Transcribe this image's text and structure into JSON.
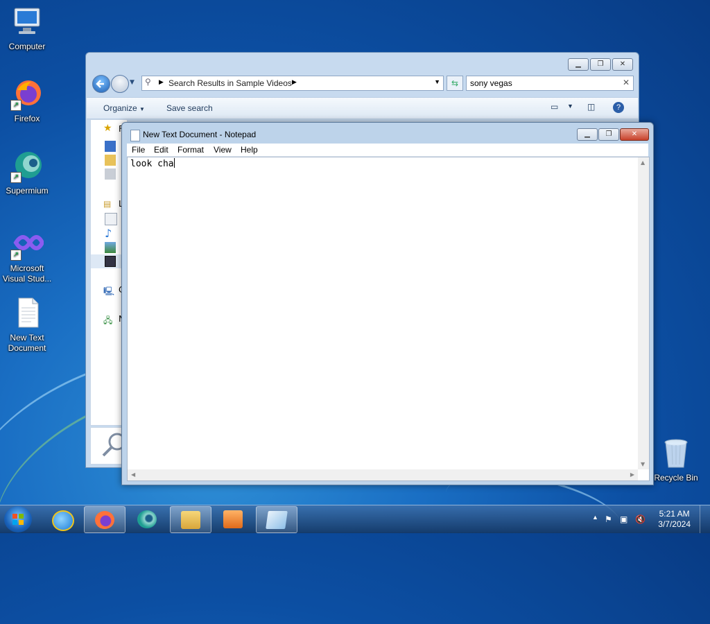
{
  "desktop": {
    "icons": [
      {
        "label": "Computer"
      },
      {
        "label": "Firefox"
      },
      {
        "label": "Supermium"
      },
      {
        "label": "Microsoft Visual Stud..."
      },
      {
        "label": "New Text Document"
      },
      {
        "label": "Recycle Bin"
      }
    ]
  },
  "explorer": {
    "breadcrumb": "Search Results in Sample Videos",
    "search_value": "sony vegas",
    "toolbar": {
      "organize": "Organize",
      "save_search": "Save search"
    },
    "nav_partial": [
      "F",
      "L",
      "C",
      "N"
    ]
  },
  "notepad": {
    "title": "New Text Document - Notepad",
    "menu": [
      "File",
      "Edit",
      "Format",
      "View",
      "Help"
    ],
    "content": "look cha"
  },
  "taskbar": {
    "time": "5:21 AM",
    "date": "3/7/2024"
  },
  "colors": {
    "close_button": "#c8412a",
    "taskbar": "#1e4a80",
    "desktop": "#0c4fa3"
  }
}
